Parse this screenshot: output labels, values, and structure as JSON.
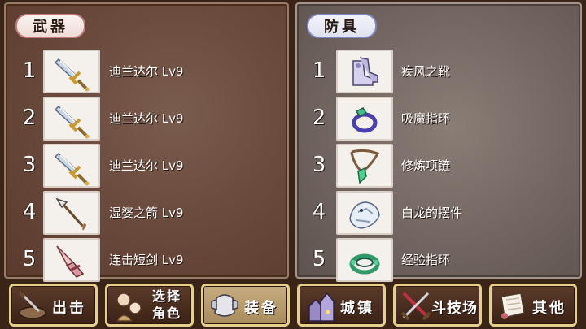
{
  "weapons": {
    "title": "武器",
    "items": [
      {
        "num": "1",
        "name": "迪兰达尔 Lv9",
        "icon": "sword-icon"
      },
      {
        "num": "2",
        "name": "迪兰达尔 Lv9",
        "icon": "sword-icon"
      },
      {
        "num": "3",
        "name": "迪兰达尔 Lv9",
        "icon": "sword-icon"
      },
      {
        "num": "4",
        "name": "湿婆之箭 Lv9",
        "icon": "arrow-icon"
      },
      {
        "num": "5",
        "name": "连击短剑 Lv9",
        "icon": "dagger-icon"
      }
    ]
  },
  "armor": {
    "title": "防具",
    "items": [
      {
        "num": "1",
        "name": "疾风之靴",
        "icon": "boots-icon"
      },
      {
        "num": "2",
        "name": "吸魔指环",
        "icon": "ring-icon"
      },
      {
        "num": "3",
        "name": "修炼项链",
        "icon": "necklace-icon"
      },
      {
        "num": "4",
        "name": "白龙的摆件",
        "icon": "dragon-ornament-icon"
      },
      {
        "num": "5",
        "name": "经验指环",
        "icon": "green-ring-icon"
      }
    ]
  },
  "nav": {
    "sortie": "出击",
    "select_line1": "选择",
    "select_line2": "角色",
    "equip": "装备",
    "town": "城镇",
    "arena": "斗技场",
    "other": "其他",
    "active": "equip"
  }
}
